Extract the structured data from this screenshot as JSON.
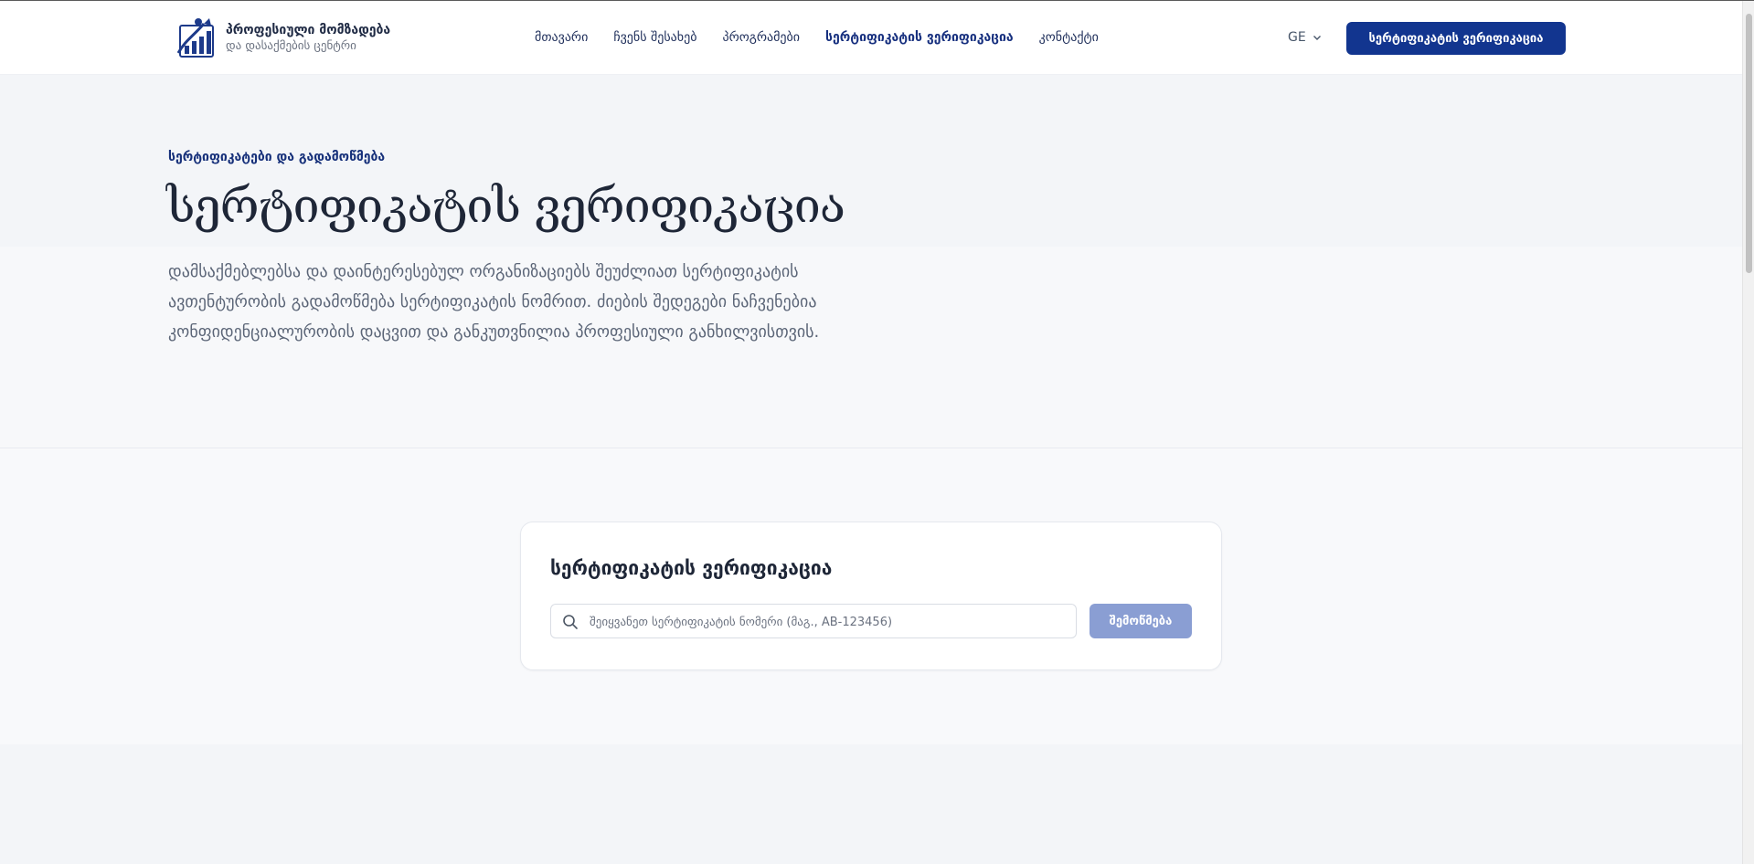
{
  "header": {
    "brand_name": "პროფესიული მომზადება",
    "brand_sub": "და დასაქმების ცენტრი",
    "nav": [
      {
        "label": "მთავარი"
      },
      {
        "label": "ჩვენს შესახებ"
      },
      {
        "label": "პროგრამები"
      },
      {
        "label": "სერტიფიკატის ვერიფიკაცია",
        "active": true
      },
      {
        "label": "კონტაქტი"
      }
    ],
    "lang": "GE",
    "cta_label": "სერტიფიკატის ვერიფიკაცია"
  },
  "hero": {
    "eyebrow": "სერტიფიკატები და გადამოწმება",
    "title": "სერტიფიკატის ვერიფიკაცია",
    "description": "დამსაქმებლებსა და დაინტერესებულ ორგანიზაციებს შეუძლიათ სერტიფიკატის ავთენტურობის გადამოწმება სერტიფიკატის ნომრით. ძიების შედეგები ნაჩვენებია კონფიდენციალურობის დაცვით და განკუთვნილია პროფესიული განხილვისთვის."
  },
  "verify": {
    "title": "სერტიფიკატის ვერიფიკაცია",
    "input_value": "",
    "placeholder": "შეიყვანეთ სერტიფიკატის ნომერი (მაგ., AB-123456)",
    "button_label": "შემოწმება"
  },
  "colors": {
    "accent": "#12358f",
    "button_disabled": "#8a9ed3"
  }
}
